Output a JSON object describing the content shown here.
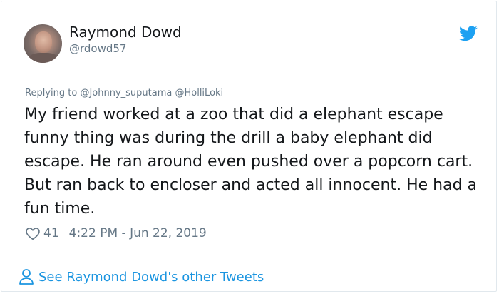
{
  "author": {
    "name": "Raymond Dowd",
    "handle": "@rdowd57"
  },
  "reply": {
    "prefix": "Replying to",
    "mentions": [
      "@Johnny_suputama",
      "@HolliLoki"
    ]
  },
  "tweet": {
    "text": "My friend worked at a zoo that did a elephant escape funny thing was during the drill a baby elephant did escape. He ran around even pushed over a popcorn cart. But ran back to encloser and acted all innocent. He had a fun time.",
    "likes": "41",
    "timestamp": "4:22 PM - Jun 22, 2019"
  },
  "footer": {
    "more_tweets": "See Raymond Dowd's other Tweets"
  },
  "icons": {
    "brand": "twitter-bird-icon",
    "like": "heart-icon",
    "profile": "person-icon"
  },
  "colors": {
    "twitter_blue": "#1da1f2",
    "link_blue": "#1b95e0",
    "muted": "#657786",
    "text": "#14171a"
  }
}
